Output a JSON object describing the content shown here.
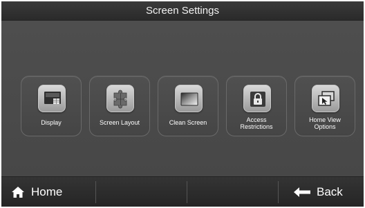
{
  "title_bar": {
    "title": "Screen Settings"
  },
  "tiles": [
    {
      "label": "Display",
      "icon": "display-icon"
    },
    {
      "label": "Screen Layout",
      "icon": "puzzle-icon"
    },
    {
      "label": "Clean Screen",
      "icon": "clean-screen-icon"
    },
    {
      "label_line1": "Access",
      "label_line2": "Restrictions",
      "icon": "lock-icon"
    },
    {
      "label_line1": "Home View",
      "label_line2": "Options",
      "icon": "cursor-window-icon"
    }
  ],
  "bottom_bar": {
    "home_label": "Home",
    "home_icon": "house-icon",
    "back_label": "Back",
    "back_icon": "arrow-left-icon"
  }
}
